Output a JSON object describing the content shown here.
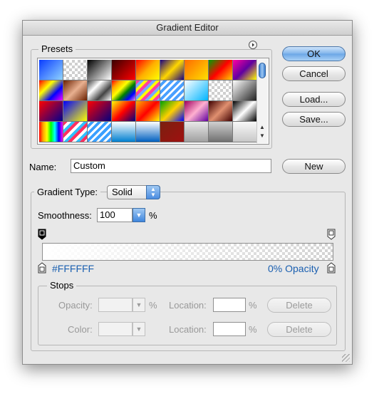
{
  "window": {
    "title": "Gradient Editor"
  },
  "presets": {
    "legend": "Presets",
    "menu_icon": "circle-arrow-right-icon",
    "swatches": [
      "linear-gradient(135deg,#0a3cff,#8fd3ff)",
      "repeating-conic-gradient(#cfcfcf 0 25%,#ffffff 0 50%) 0 0/8px 8px",
      "linear-gradient(135deg,#000,#fff)",
      "linear-gradient(135deg,#3a0000,#ff0000)",
      "linear-gradient(135deg,#ff0000,#ffb000,#ffff00)",
      "linear-gradient(135deg,#1a0080,#ffd700,#1a0080)",
      "linear-gradient(135deg,#ff6a00,#ffe000)",
      "linear-gradient(135deg,#00a000,#ff0000,#ffd000)",
      "linear-gradient(135deg,#ff00a0,#6000a0,#ffff00)",
      "linear-gradient(135deg,#ff0000,#ffff00,#0000ff,#ff00ff)",
      "linear-gradient(135deg,#6a2000,#e8b090,#6a2000)",
      "linear-gradient(135deg,#444,#fff,#444,#fff)",
      "linear-gradient(135deg,red,orange,yellow,green,blue,violet)",
      "repeating-linear-gradient(135deg,#ff3fa0 0 4px,#7af 4px 8px,#ff0 8px 12px)",
      "repeating-linear-gradient(135deg,#fff 0 3px,#4aa0ff 3px 7px)",
      "linear-gradient(135deg,#ffffff,#00b4ff)",
      "repeating-conic-gradient(#cfcfcf 0 25%,#ffffff 0 50%) 0 0/8px 8px",
      "linear-gradient(135deg,#ffffff,#222222)",
      "linear-gradient(135deg,#ff0000,#000090)",
      "linear-gradient(135deg,#0000ff,#ffff00)",
      "linear-gradient(135deg,#ff0000,#000080)",
      "linear-gradient(135deg,#ffff00,#ff0000,#000080)",
      "linear-gradient(135deg,#ffb000,#ff0000,#ffff00)",
      "linear-gradient(135deg,#00a000,#ffd000,#0000ff)",
      "linear-gradient(135deg,#a00060,#ffb0d0,#6000a0)",
      "linear-gradient(135deg,#400000,#e09070,#400000)",
      "linear-gradient(135deg,#000,#fff,#000)",
      "linear-gradient(90deg,red,orange,yellow,lime,cyan,blue,magenta)",
      "repeating-linear-gradient(135deg,#ff3060 0 4px,#fff 4px 8px,#30c0ff 8px 12px)",
      "repeating-linear-gradient(135deg,#fff 0 3px,#3aa0ff 3px 7px)",
      "linear-gradient(180deg,#ffffff,#0080d0)",
      "linear-gradient(180deg,#ffffff,#0060c0)",
      "linear-gradient(135deg,#7a2010,#a01010)",
      "linear-gradient(180deg,#e8e8e8,#a0a0a0)",
      "linear-gradient(180deg,#d0d0d0,#707070)",
      "linear-gradient(180deg,#f8f8f8,#c8c8c8)"
    ]
  },
  "buttons": {
    "ok": "OK",
    "cancel": "Cancel",
    "load": "Load...",
    "save": "Save...",
    "new": "New"
  },
  "name": {
    "label": "Name:",
    "value": "Custom"
  },
  "gradient_type": {
    "legend": "Gradient Type:",
    "selected": "Solid"
  },
  "smoothness": {
    "label": "Smoothness:",
    "value": "100",
    "unit": "%"
  },
  "gradient": {
    "start_color": "#FFFFFF",
    "end_opacity_text": "0% Opacity"
  },
  "stops": {
    "legend": "Stops",
    "opacity_label": "Opacity:",
    "opacity_value": "",
    "opacity_unit": "%",
    "opacity_location_label": "Location:",
    "opacity_location_value": "",
    "opacity_location_unit": "%",
    "opacity_delete": "Delete",
    "color_label": "Color:",
    "color_location_label": "Location:",
    "color_location_value": "",
    "color_location_unit": "%",
    "color_delete": "Delete"
  }
}
